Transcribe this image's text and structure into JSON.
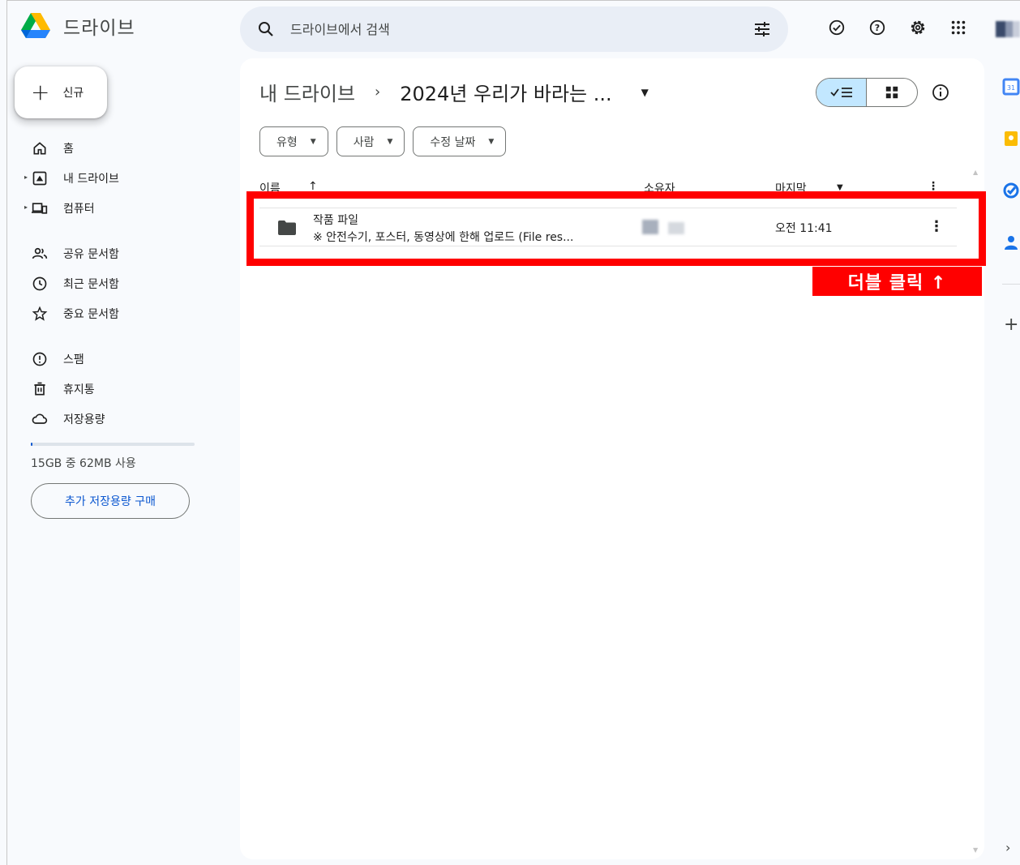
{
  "app": {
    "name": "드라이브",
    "logo_icon": "google-drive-logo"
  },
  "search": {
    "placeholder": "드라이브에서 검색",
    "icon": "search-icon",
    "filter_icon": "tune-icon"
  },
  "top_icons": [
    "offline-ready-icon",
    "help-icon",
    "settings-icon",
    "apps-grid-icon"
  ],
  "sidebar": {
    "new_label": "신규",
    "items": [
      {
        "label": "홈",
        "icon": "home-icon"
      },
      {
        "label": "내 드라이브",
        "icon": "my-drive-icon",
        "expandable": true
      },
      {
        "label": "컴퓨터",
        "icon": "computers-icon",
        "expandable": true
      },
      {
        "label": "공유 문서함",
        "icon": "shared-icon"
      },
      {
        "label": "최근 문서함",
        "icon": "recent-icon"
      },
      {
        "label": "중요 문서함",
        "icon": "star-icon"
      },
      {
        "label": "스팸",
        "icon": "spam-icon"
      },
      {
        "label": "휴지통",
        "icon": "trash-icon"
      },
      {
        "label": "저장용량",
        "icon": "cloud-icon"
      }
    ],
    "storage_text": "15GB 중 62MB 사용",
    "storage_fraction": 0.004,
    "buy_label": "추가 저장용량 구매"
  },
  "main": {
    "breadcrumb_root": "내 드라이브",
    "breadcrumb_current": "2024년 우리가 바라는 ...",
    "view_mode": "list",
    "filters": [
      "유형",
      "사람",
      "수정 날짜"
    ],
    "columns": {
      "name": "이름",
      "owner": "소유자",
      "modified": "마지막"
    },
    "rows": [
      {
        "name": "작품 파일",
        "description": "※ 안전수기, 포스터, 동영상에 한해 업로드 (File res...",
        "modified": "오전 11:41"
      }
    ]
  },
  "annotation": {
    "label": "더블 클릭 ↑",
    "color": "#ff0000"
  },
  "colors": {
    "accent": "#0b57d0",
    "selected_toggle": "#c2e7ff",
    "search_bg": "#e9eef6",
    "page_bg": "#f8fafd"
  },
  "right_panel_icons": [
    "calendar-icon",
    "keep-icon",
    "tasks-icon",
    "contacts-icon",
    "add-icon"
  ]
}
